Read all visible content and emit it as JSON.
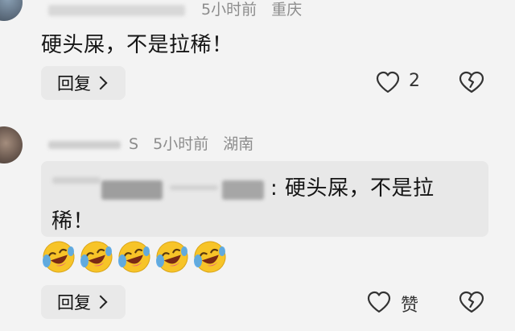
{
  "comment1": {
    "time": "5小时前",
    "location": "重庆",
    "text": "硬头屎，不是拉稀！",
    "reply_label": "回复",
    "like_count": "2"
  },
  "comment2": {
    "name_tail": "S",
    "time": "5小时前",
    "location": "湖南",
    "quote_suffix": ": 硬头屎，不是拉",
    "quote_line2": "稀！",
    "emojis": [
      "crying-laughing-emoji",
      "crying-laughing-emoji",
      "crying-laughing-emoji",
      "crying-laughing-emoji",
      "crying-laughing-emoji"
    ],
    "reply_label": "回复",
    "like_label": "赞"
  },
  "colors": {
    "background": "#f3f3f3",
    "reply_bg": "#e9e9e9",
    "meta_text": "#8c8c8c",
    "emoji_face": "#f7c428"
  }
}
